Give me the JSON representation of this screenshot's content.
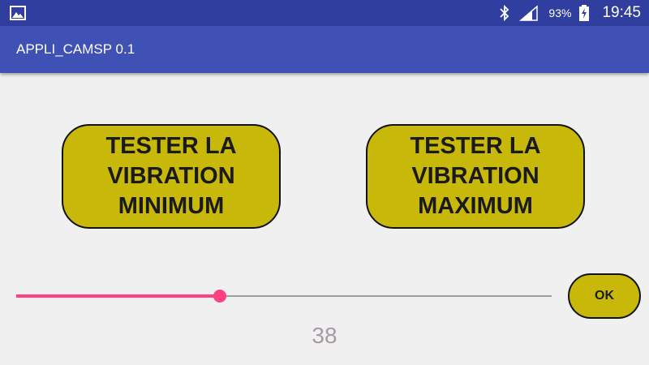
{
  "status_bar": {
    "icons": [
      "gallery-icon",
      "bluetooth-icon",
      "signal-icon",
      "battery-charging-icon"
    ],
    "battery_percent": "93%",
    "time": "19:45"
  },
  "app_bar": {
    "title": "APPLI_CAMSP 0.1"
  },
  "buttons": {
    "min_label": "TESTER LA\nVIBRATION\nMINIMUM",
    "max_label": "TESTER LA\nVIBRATION\nMAXIMUM",
    "ok_label": "OK"
  },
  "slider": {
    "value": 38,
    "max": 100,
    "value_label": "38"
  },
  "colors": {
    "status_bar": "#303f9f",
    "app_bar": "#3f51b5",
    "button_fill": "#c8b80a",
    "slider_accent": "#ff4081",
    "background": "#f0f0f0"
  }
}
